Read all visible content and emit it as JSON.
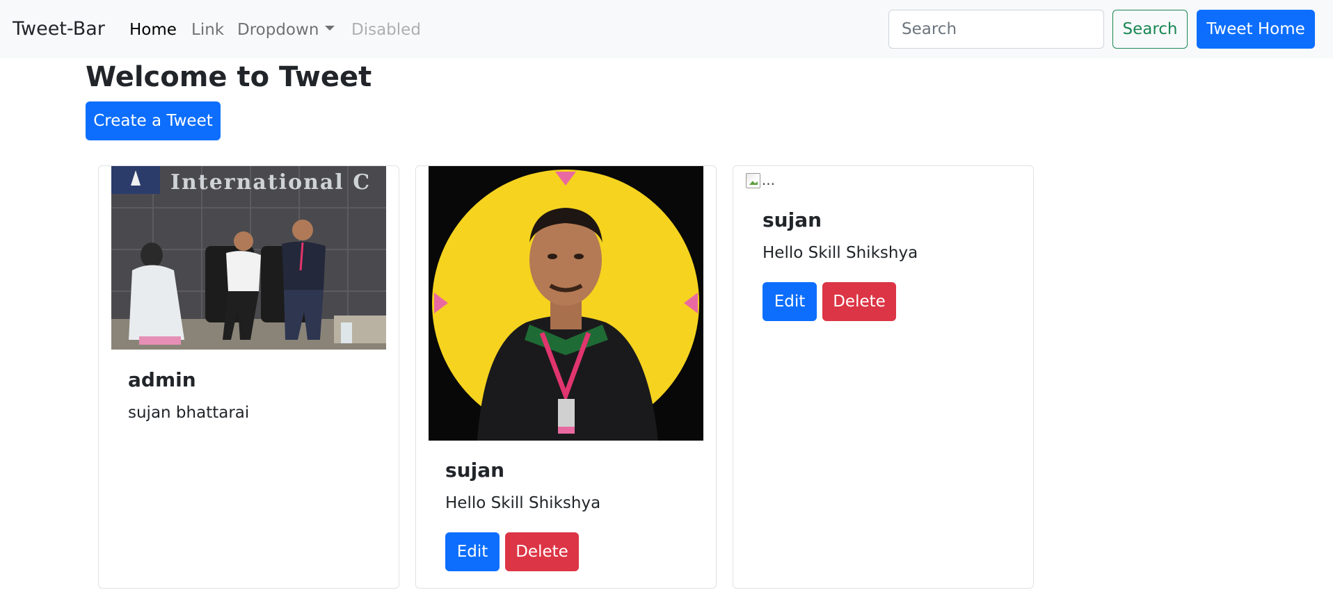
{
  "navbar": {
    "brand": "Tweet-Bar",
    "links": [
      {
        "label": "Home"
      },
      {
        "label": "Link"
      },
      {
        "label": "Dropdown"
      },
      {
        "label": "Disabled"
      }
    ],
    "search_placeholder": "Search",
    "search_button": "Search",
    "tweet_home_button": "Tweet Home"
  },
  "page": {
    "title": "Welcome to Tweet",
    "create_button": "Create a Tweet"
  },
  "tweets": [
    {
      "username": "admin",
      "text": "sujan bhattarai",
      "image": "group-photo"
    },
    {
      "username": "sujan",
      "text": "Hello Skill Shikshya",
      "image": "profile-photo",
      "edit_label": "Edit",
      "delete_label": "Delete"
    },
    {
      "username": "sujan",
      "text": "Hello Skill Shikshya",
      "image_alt": "...",
      "edit_label": "Edit",
      "delete_label": "Delete"
    }
  ],
  "colors": {
    "primary": "#0d6efd",
    "danger": "#dc3545",
    "success": "#198754",
    "navbar_bg": "#f8f9fa"
  }
}
